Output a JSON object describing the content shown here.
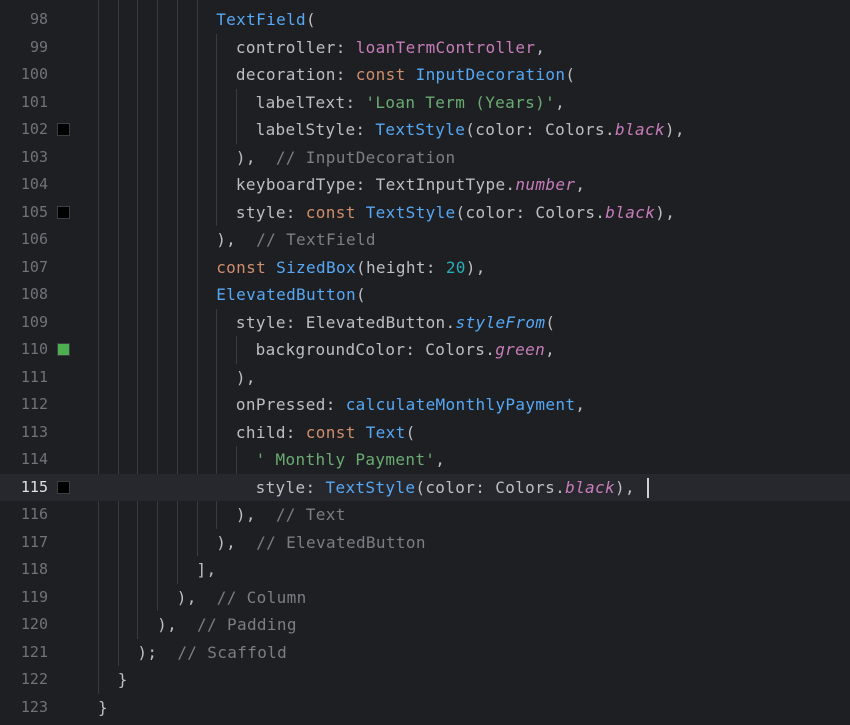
{
  "editor": {
    "language": "dart",
    "current_line": 115,
    "colors": {
      "background": "#1e1f22",
      "current_line": "#26282e",
      "line_number": "#6f737a",
      "keyword": "#cf8e6d",
      "class": "#56a8f5",
      "string": "#6aab73",
      "number": "#2aacb8",
      "comment": "#7a7e85",
      "field": "#c77dbb"
    },
    "lines": [
      {
        "n": "98",
        "indent": 6,
        "tokens": [
          {
            "t": "TextField",
            "c": "cls"
          },
          {
            "t": "(",
            "c": "default"
          }
        ]
      },
      {
        "n": "99",
        "indent": 7,
        "tokens": [
          {
            "t": "controller: ",
            "c": "default"
          },
          {
            "t": "loanTermController",
            "c": "prop"
          },
          {
            "t": ",",
            "c": "default"
          }
        ]
      },
      {
        "n": "100",
        "indent": 7,
        "tokens": [
          {
            "t": "decoration: ",
            "c": "default"
          },
          {
            "t": "const ",
            "c": "kw"
          },
          {
            "t": "InputDecoration",
            "c": "cls"
          },
          {
            "t": "(",
            "c": "default"
          }
        ]
      },
      {
        "n": "101",
        "indent": 8,
        "tokens": [
          {
            "t": "labelText: ",
            "c": "default"
          },
          {
            "t": "'Loan Term (Years)'",
            "c": "str"
          },
          {
            "t": ",",
            "c": "default"
          }
        ]
      },
      {
        "n": "102",
        "indent": 8,
        "swatch": "#000000",
        "tokens": [
          {
            "t": "labelStyle: ",
            "c": "default"
          },
          {
            "t": "TextStyle",
            "c": "cls"
          },
          {
            "t": "(color: Colors.",
            "c": "default"
          },
          {
            "t": "black",
            "c": "it"
          },
          {
            "t": "),",
            "c": "default"
          }
        ]
      },
      {
        "n": "103",
        "indent": 7,
        "tokens": [
          {
            "t": "),  ",
            "c": "default"
          },
          {
            "t": "// InputDecoration",
            "c": "cmt"
          }
        ]
      },
      {
        "n": "104",
        "indent": 7,
        "tokens": [
          {
            "t": "keyboardType: TextInputType.",
            "c": "default"
          },
          {
            "t": "number",
            "c": "it"
          },
          {
            "t": ",",
            "c": "default"
          }
        ]
      },
      {
        "n": "105",
        "indent": 7,
        "swatch": "#000000",
        "tokens": [
          {
            "t": "style: ",
            "c": "default"
          },
          {
            "t": "const ",
            "c": "kw"
          },
          {
            "t": "TextStyle",
            "c": "cls"
          },
          {
            "t": "(color: Colors.",
            "c": "default"
          },
          {
            "t": "black",
            "c": "it"
          },
          {
            "t": "),",
            "c": "default"
          }
        ]
      },
      {
        "n": "106",
        "indent": 6,
        "tokens": [
          {
            "t": "),  ",
            "c": "default"
          },
          {
            "t": "// TextField",
            "c": "cmt"
          }
        ]
      },
      {
        "n": "107",
        "indent": 6,
        "tokens": [
          {
            "t": "const ",
            "c": "kw"
          },
          {
            "t": "SizedBox",
            "c": "cls"
          },
          {
            "t": "(height: ",
            "c": "default"
          },
          {
            "t": "20",
            "c": "num"
          },
          {
            "t": "),",
            "c": "default"
          }
        ]
      },
      {
        "n": "108",
        "indent": 6,
        "tokens": [
          {
            "t": "ElevatedButton",
            "c": "cls"
          },
          {
            "t": "(",
            "c": "default"
          }
        ]
      },
      {
        "n": "109",
        "indent": 7,
        "tokens": [
          {
            "t": "style: ElevatedButton.",
            "c": "default"
          },
          {
            "t": "styleFrom",
            "c": "itb"
          },
          {
            "t": "(",
            "c": "default"
          }
        ]
      },
      {
        "n": "110",
        "indent": 8,
        "swatch": "#4caf50",
        "tokens": [
          {
            "t": "backgroundColor: Colors.",
            "c": "default"
          },
          {
            "t": "green",
            "c": "it"
          },
          {
            "t": ",",
            "c": "default"
          }
        ]
      },
      {
        "n": "111",
        "indent": 7,
        "tokens": [
          {
            "t": "),",
            "c": "default"
          }
        ]
      },
      {
        "n": "112",
        "indent": 7,
        "tokens": [
          {
            "t": "onPressed: ",
            "c": "default"
          },
          {
            "t": "calculateMonthlyPayment",
            "c": "cls"
          },
          {
            "t": ",",
            "c": "default"
          }
        ]
      },
      {
        "n": "113",
        "indent": 7,
        "tokens": [
          {
            "t": "child: ",
            "c": "default"
          },
          {
            "t": "const ",
            "c": "kw"
          },
          {
            "t": "Text",
            "c": "cls"
          },
          {
            "t": "(",
            "c": "default"
          }
        ]
      },
      {
        "n": "114",
        "indent": 8,
        "tokens": [
          {
            "t": "' Monthly Payment'",
            "c": "str"
          },
          {
            "t": ",",
            "c": "default"
          }
        ]
      },
      {
        "n": "115",
        "indent": 8,
        "swatch": "#000000",
        "current": true,
        "caret": true,
        "tokens": [
          {
            "t": "style: ",
            "c": "default"
          },
          {
            "t": "TextStyle",
            "c": "cls"
          },
          {
            "t": "(color: Colors.",
            "c": "default"
          },
          {
            "t": "black",
            "c": "it"
          },
          {
            "t": "), ",
            "c": "default"
          }
        ]
      },
      {
        "n": "116",
        "indent": 7,
        "tokens": [
          {
            "t": "),  ",
            "c": "default"
          },
          {
            "t": "// Text",
            "c": "cmt"
          }
        ]
      },
      {
        "n": "117",
        "indent": 6,
        "tokens": [
          {
            "t": "),  ",
            "c": "default"
          },
          {
            "t": "// ElevatedButton",
            "c": "cmt"
          }
        ]
      },
      {
        "n": "118",
        "indent": 5,
        "tokens": [
          {
            "t": "],",
            "c": "default"
          }
        ]
      },
      {
        "n": "119",
        "indent": 4,
        "tokens": [
          {
            "t": "),  ",
            "c": "default"
          },
          {
            "t": "// Column",
            "c": "cmt"
          }
        ]
      },
      {
        "n": "120",
        "indent": 3,
        "tokens": [
          {
            "t": "),  ",
            "c": "default"
          },
          {
            "t": "// Padding",
            "c": "cmt"
          }
        ]
      },
      {
        "n": "121",
        "indent": 2,
        "tokens": [
          {
            "t": ");  ",
            "c": "default"
          },
          {
            "t": "// Scaffold",
            "c": "cmt"
          }
        ]
      },
      {
        "n": "122",
        "indent": 1,
        "tokens": [
          {
            "t": "}",
            "c": "default"
          }
        ]
      },
      {
        "n": "123",
        "indent": 0,
        "tokens": [
          {
            "t": "}",
            "c": "default"
          }
        ]
      }
    ]
  }
}
